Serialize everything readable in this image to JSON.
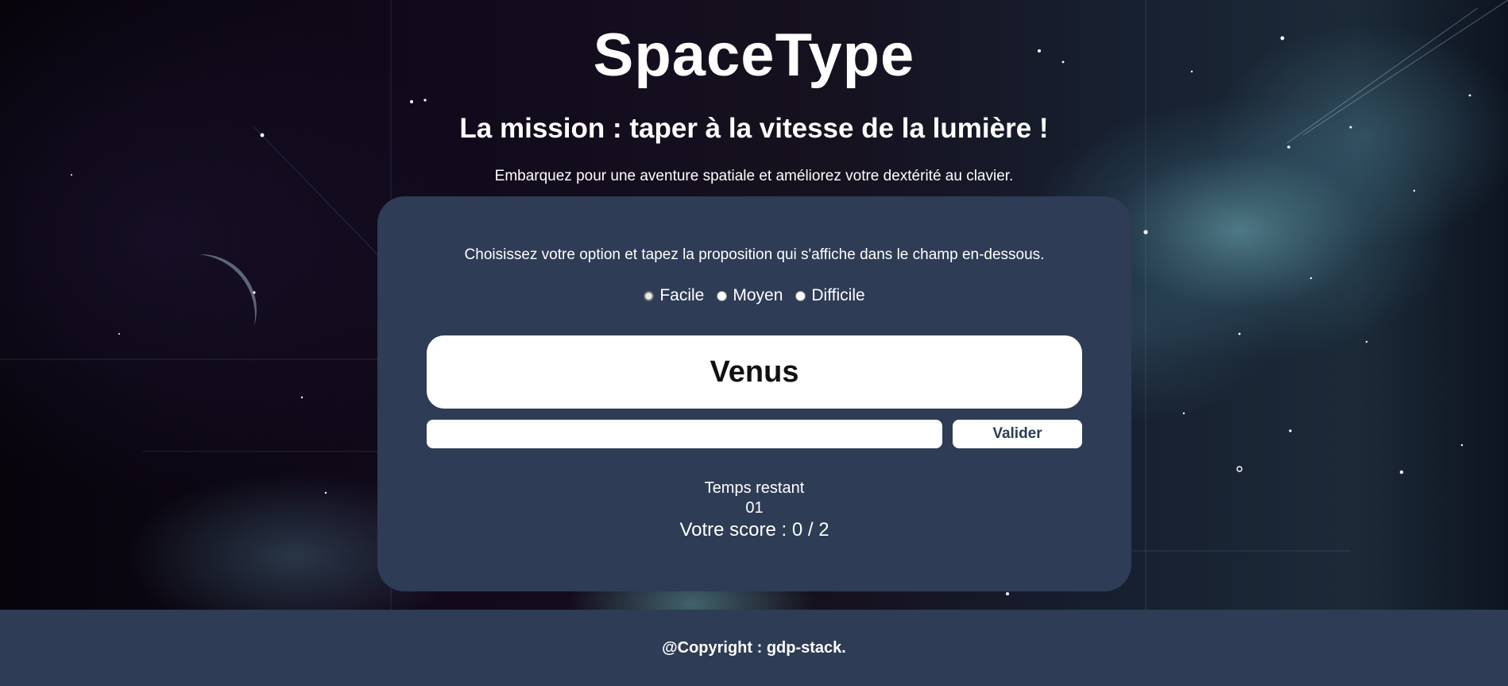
{
  "header": {
    "title": "SpaceType",
    "subtitle": "La mission : taper à la vitesse de la lumière !",
    "tagline": "Embarquez pour une aventure spatiale et améliorez votre dextérité au clavier."
  },
  "game": {
    "instruction": "Choisissez votre option et tapez la proposition qui s'affiche dans le champ en-dessous.",
    "options": [
      {
        "label": "Facile",
        "selected": true
      },
      {
        "label": "Moyen",
        "selected": false
      },
      {
        "label": "Difficile",
        "selected": false
      }
    ],
    "current_word": "Venus",
    "input_value": "",
    "validate_label": "Valider",
    "timer_label": "Temps restant",
    "timer_value": "01",
    "score_text": "Votre score : 0 / 2"
  },
  "footer": {
    "copyright": "@Copyright : gdp-stack."
  },
  "colors": {
    "card": "#2e3c55",
    "footer": "#2e3c55",
    "text": "#ffffff"
  }
}
